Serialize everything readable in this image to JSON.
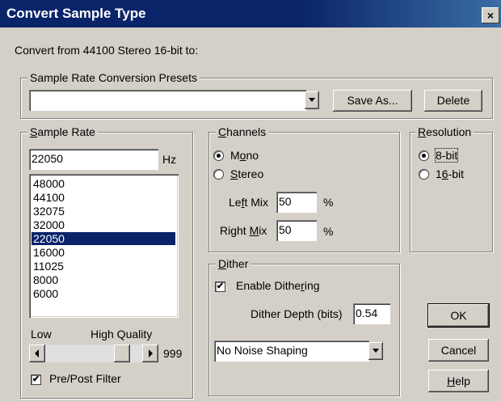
{
  "window": {
    "title": "Convert Sample Type",
    "close_label": "×"
  },
  "header_text": "Convert from 44100 Stereo 16-bit to:",
  "presets": {
    "legend": "Sample Rate Conversion Presets",
    "value": "",
    "save_as_label": "Save As...",
    "delete_label": "Delete"
  },
  "sample_rate": {
    "legend_prefix": "",
    "legend_accel": "S",
    "legend_rest": "ample Rate",
    "value": "22050",
    "unit": "Hz",
    "options": [
      "48000",
      "44100",
      "32075",
      "32000",
      "22050",
      "16000",
      "11025",
      "8000",
      "6000"
    ],
    "selected": "22050",
    "quality_low": "Low",
    "quality_high": "High Quality",
    "quality_value": "999",
    "quality_fraction": 0.85,
    "prepost_filter_label": "Pre/Post Filter",
    "prepost_filter_checked": true
  },
  "channels": {
    "legend_accel": "C",
    "legend_rest": "hannels",
    "mono_pre": "M",
    "mono_accel": "o",
    "mono_post": "no",
    "stereo_pre": "",
    "stereo_accel": "S",
    "stereo_post": "tereo",
    "selected": "Mono",
    "left_mix_pre": "Le",
    "left_mix_accel": "f",
    "left_mix_post": "t Mix",
    "left_mix_value": "50",
    "right_mix_pre": "Right ",
    "right_mix_accel": "M",
    "right_mix_post": "ix",
    "right_mix_value": "50",
    "percent": "%"
  },
  "resolution": {
    "legend_accel": "R",
    "legend_rest": "esolution",
    "opt1_label": "8-bit",
    "opt2_pre": "1",
    "opt2_accel": "6",
    "opt2_post": "-bit",
    "selected": "8-bit"
  },
  "dither": {
    "legend_accel": "D",
    "legend_rest": "ither",
    "enable_pre": "Enable Dithe",
    "enable_accel": "r",
    "enable_post": "ing",
    "enable_checked": true,
    "depth_label": "Dither Depth (bits)",
    "depth_value": "0.54",
    "noise_shaping": "No Noise Shaping"
  },
  "buttons": {
    "ok": "OK",
    "cancel": "Cancel",
    "help_accel": "H",
    "help_rest": "elp"
  },
  "icons": {
    "check": "✔",
    "dropdown": "chevron-down-icon"
  }
}
